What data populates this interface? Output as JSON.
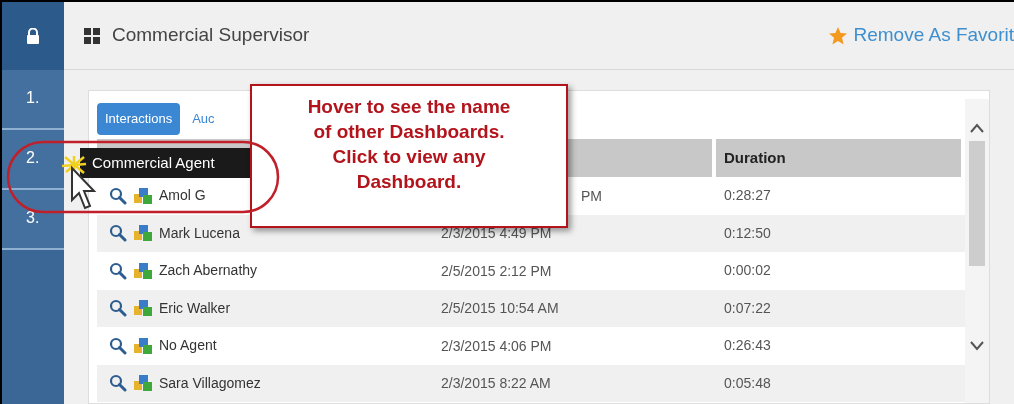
{
  "sidebar": {
    "items": [
      {
        "label": "1."
      },
      {
        "label": "2."
      },
      {
        "label": "3."
      }
    ]
  },
  "header": {
    "title": "Commercial Supervisor",
    "favorite_link": "Remove As Favorit"
  },
  "tabs": [
    {
      "label": "Interactions",
      "selected": true
    },
    {
      "label": "Auc",
      "selected": false
    }
  ],
  "table": {
    "columns": [
      {
        "label": "Duration"
      }
    ],
    "rows": [
      {
        "name": "Amol G",
        "date": "PM",
        "duration": "0:28:27"
      },
      {
        "name": "Mark Lucena",
        "date": "2/3/2015 4:49 PM",
        "duration": "0:12:50"
      },
      {
        "name": "Zach Abernathy",
        "date": "2/5/2015 2:12 PM",
        "duration": "0:00:02"
      },
      {
        "name": "Eric Walker",
        "date": "2/5/2015 10:54 AM",
        "duration": "0:07:22"
      },
      {
        "name": "No Agent",
        "date": "2/3/2015 4:06 PM",
        "duration": "0:26:43"
      },
      {
        "name": "Sara Villagomez",
        "date": "2/3/2015 8:22 AM",
        "duration": "0:05:48"
      }
    ]
  },
  "tooltip": "Commercial Agent",
  "callout": [
    "Hover to see the name",
    "of other Dashboards.",
    "Click to view any",
    "Dashboard."
  ]
}
